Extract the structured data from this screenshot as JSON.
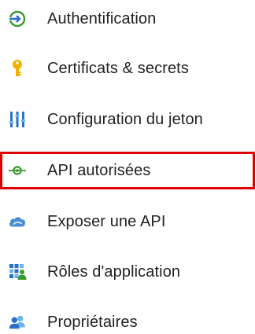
{
  "nav": {
    "items": [
      {
        "label": "Authentification",
        "icon": "authentication-icon",
        "selected": false
      },
      {
        "label": "Certificats & secrets",
        "icon": "key-icon",
        "selected": false
      },
      {
        "label": "Configuration du jeton",
        "icon": "token-configuration-icon",
        "selected": false
      },
      {
        "label": "API autorisées",
        "icon": "api-permissions-icon",
        "selected": true
      },
      {
        "label": "Exposer une API",
        "icon": "cloud-icon",
        "selected": false
      },
      {
        "label": "Rôles d'application",
        "icon": "app-roles-icon",
        "selected": false
      },
      {
        "label": "Propriétaires",
        "icon": "owners-icon",
        "selected": false
      }
    ],
    "selection_outline_color": "#e00000",
    "accent_colors": {
      "green": "#3a9a2e",
      "gold": "#f2b100",
      "blue": "#2a6fc9",
      "cloud": "#4a8fd6"
    }
  }
}
